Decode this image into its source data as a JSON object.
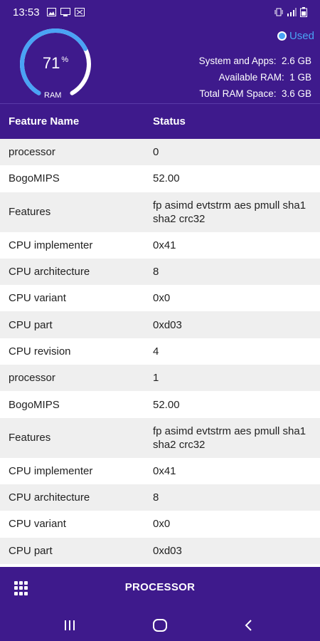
{
  "status_bar": {
    "time": "13:53",
    "icons": [
      "image-icon",
      "cast-icon",
      "screen-icon"
    ],
    "right_icons": [
      "vibrate-icon",
      "signal-icon",
      "battery-icon"
    ]
  },
  "ram": {
    "percent": "71",
    "percent_sign": "%",
    "label": "RAM",
    "fraction": 0.71,
    "legend": "Used",
    "stats": [
      {
        "label": "System and Apps:",
        "value": "2.6 GB"
      },
      {
        "label": "Available RAM:",
        "value": "1 GB"
      },
      {
        "label": "Total RAM Space:",
        "value": "3.6 GB"
      }
    ]
  },
  "table": {
    "headers": [
      "Feature Name",
      "Status"
    ],
    "rows": [
      [
        "processor",
        "0"
      ],
      [
        "BogoMIPS",
        "52.00"
      ],
      [
        "Features",
        "fp asimd evtstrm aes pmull sha1 sha2 crc32"
      ],
      [
        "CPU implementer",
        "0x41"
      ],
      [
        "CPU architecture",
        "8"
      ],
      [
        "CPU variant",
        "0x0"
      ],
      [
        "CPU part",
        "0xd03"
      ],
      [
        "CPU revision",
        "4"
      ],
      [
        "processor",
        "1"
      ],
      [
        "BogoMIPS",
        "52.00"
      ],
      [
        "Features",
        "fp asimd evtstrm aes pmull sha1 sha2 crc32"
      ],
      [
        "CPU implementer",
        "0x41"
      ],
      [
        "CPU architecture",
        "8"
      ],
      [
        "CPU variant",
        "0x0"
      ],
      [
        "CPU part",
        "0xd03"
      ]
    ]
  },
  "bottom_nav": {
    "title": "PROCESSOR"
  },
  "colors": {
    "primary": "#3e1a8c",
    "accent": "#4aa3f5",
    "stripe": "#efefef"
  }
}
